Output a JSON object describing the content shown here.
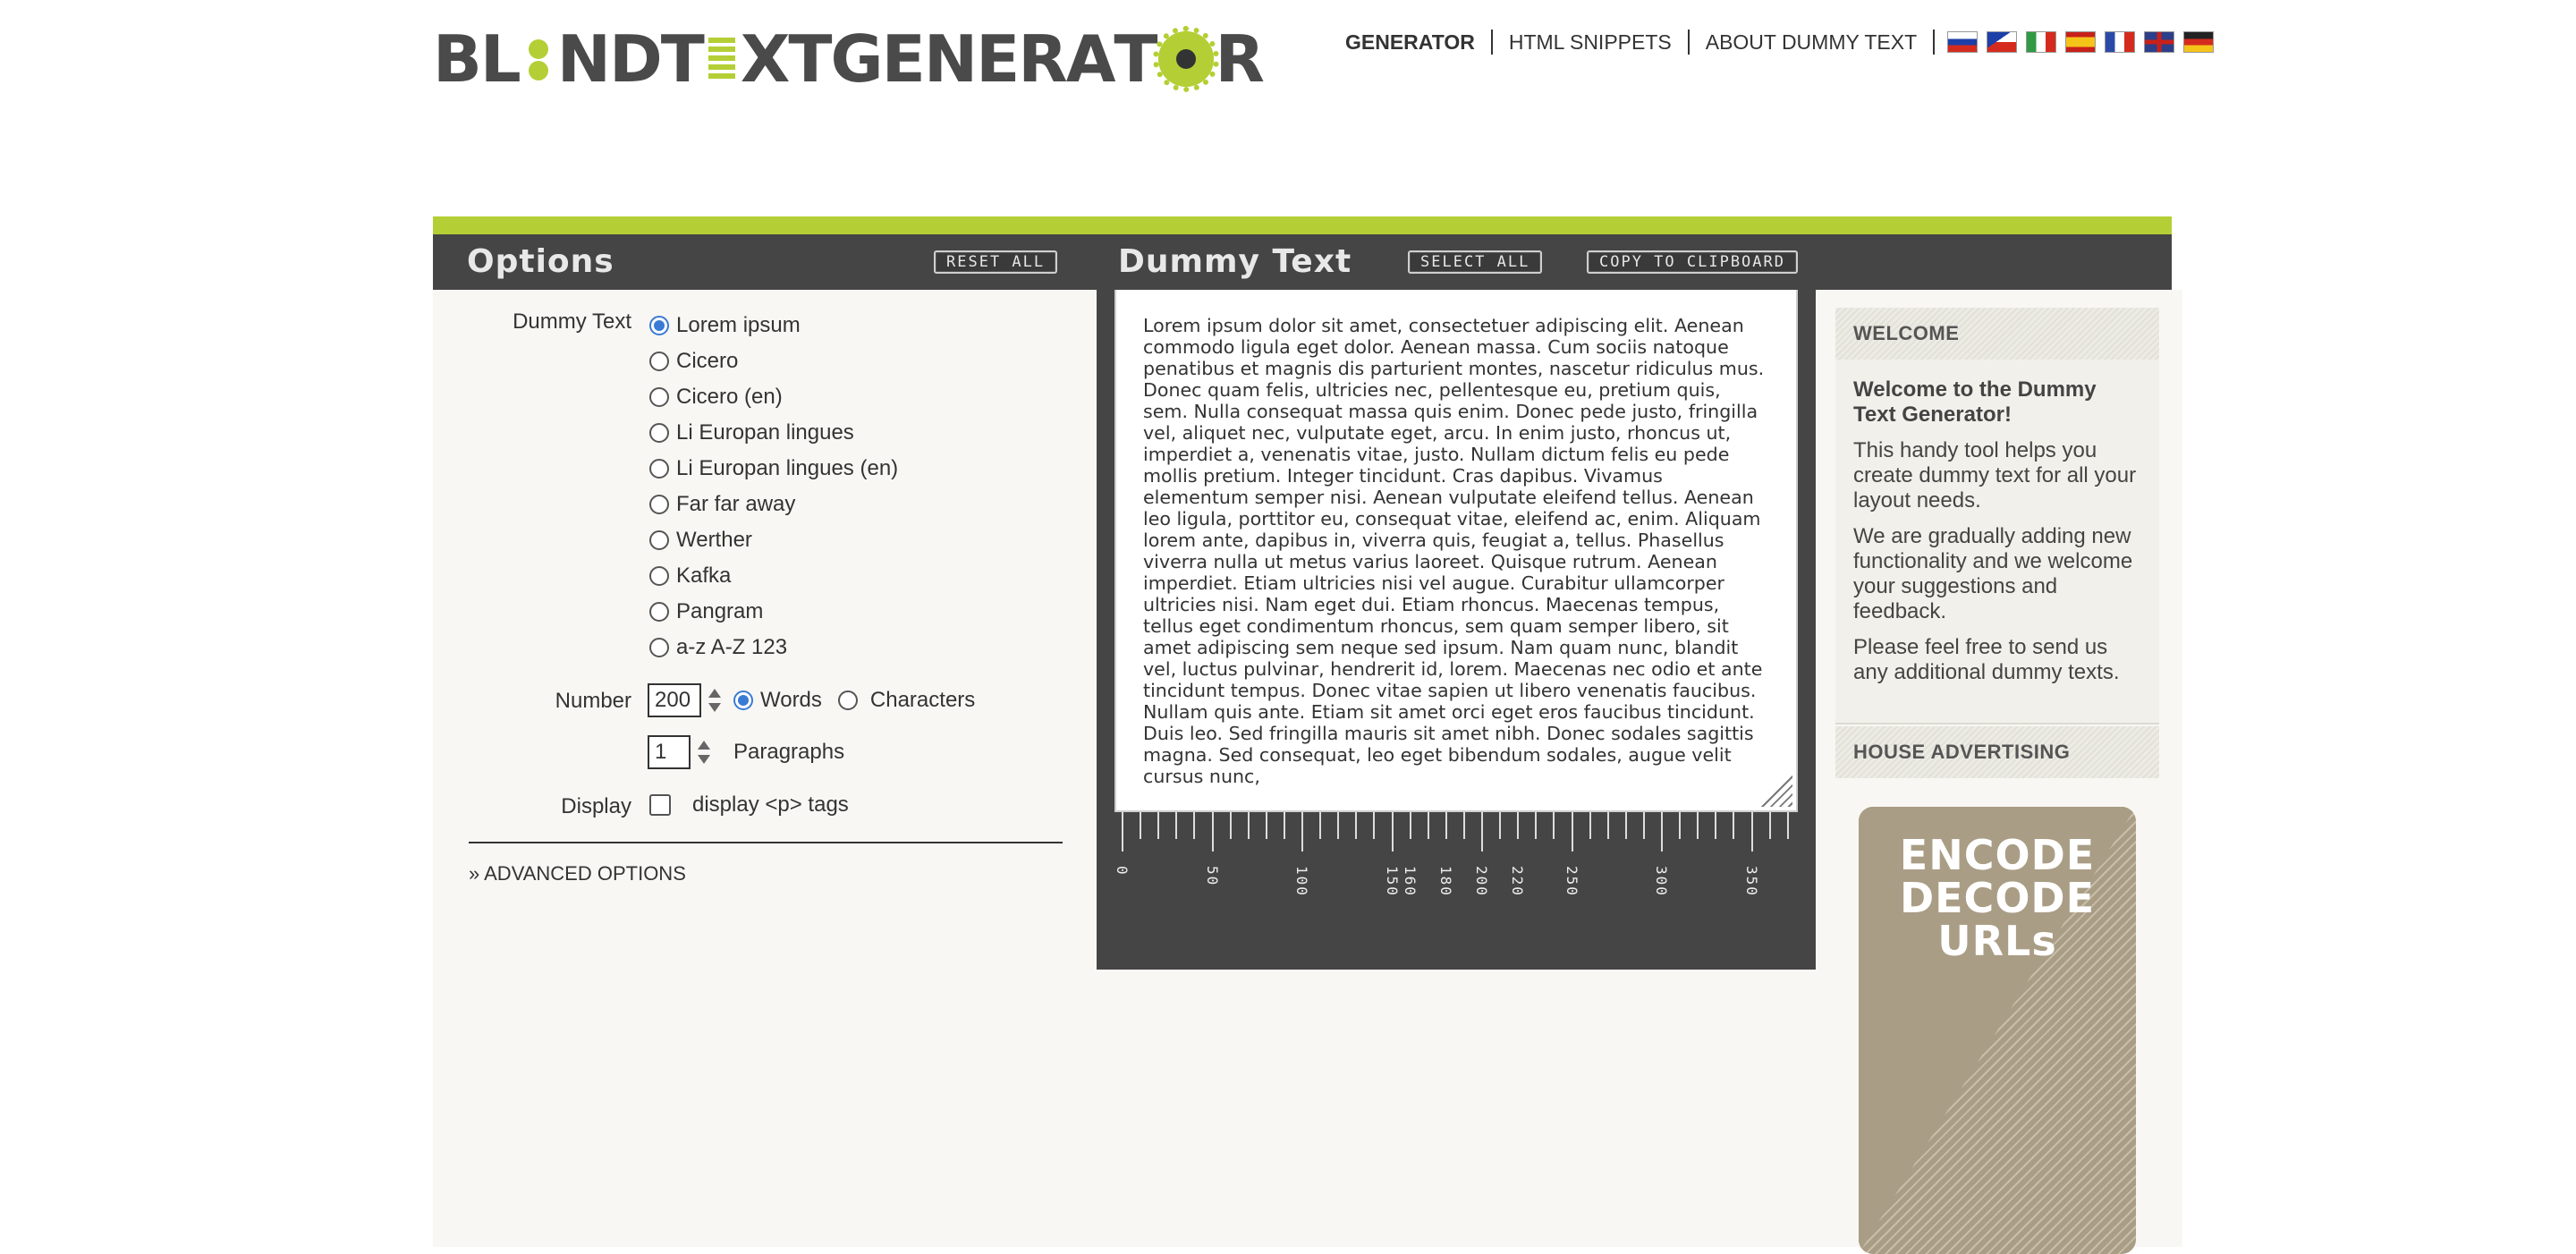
{
  "header": {
    "logo_text": "BL●NDT≡XTGENERAT●R",
    "nav": [
      {
        "label": "GENERATOR",
        "active": true
      },
      {
        "label": "HTML SNIPPETS",
        "active": false
      },
      {
        "label": "ABOUT DUMMY TEXT",
        "active": false
      }
    ],
    "flags": [
      "flag-russia-icon",
      "flag-czech-icon",
      "flag-italy-icon",
      "flag-spain-icon",
      "flag-france-icon",
      "flag-uk-icon",
      "flag-germany-icon"
    ]
  },
  "colors": {
    "accent_green": "#b4cf35",
    "dark_bar": "#454545",
    "panel_bg": "#f8f7f3"
  },
  "options": {
    "title": "Options",
    "reset_label": "RESET ALL",
    "dummy_text_label": "Dummy Text",
    "dummy_text_choices": [
      {
        "label": "Lorem ipsum",
        "selected": true
      },
      {
        "label": "Cicero",
        "selected": false
      },
      {
        "label": "Cicero (en)",
        "selected": false
      },
      {
        "label": "Li Europan lingues",
        "selected": false
      },
      {
        "label": "Li Europan lingues (en)",
        "selected": false
      },
      {
        "label": "Far far away",
        "selected": false
      },
      {
        "label": "Werther",
        "selected": false
      },
      {
        "label": "Kafka",
        "selected": false
      },
      {
        "label": "Pangram",
        "selected": false
      },
      {
        "label": "a-z A-Z 123",
        "selected": false
      }
    ],
    "number_label": "Number",
    "number_value": "200",
    "words_label": "Words",
    "words_selected": true,
    "characters_label": "Characters",
    "paragraphs_value": "1",
    "paragraphs_label": "Paragraphs",
    "display_label": "Display",
    "display_p_label": "display <p> tags",
    "display_p_checked": false,
    "advanced_label": "» ADVANCED OPTIONS"
  },
  "dummy": {
    "title": "Dummy Text",
    "select_all_label": "SELECT ALL",
    "copy_label": "COPY TO CLIPBOARD",
    "text": "Lorem ipsum dolor sit amet, consectetuer adipiscing elit. Aenean commodo ligula eget dolor. Aenean massa. Cum sociis natoque penatibus et magnis dis parturient montes, nascetur ridiculus mus. Donec quam felis, ultricies nec, pellentesque eu, pretium quis, sem. Nulla consequat massa quis enim. Donec pede justo, fringilla vel, aliquet nec, vulputate eget, arcu. In enim justo, rhoncus ut, imperdiet a, venenatis vitae, justo. Nullam dictum felis eu pede mollis pretium. Integer tincidunt. Cras dapibus. Vivamus elementum semper nisi. Aenean vulputate eleifend tellus. Aenean leo ligula, porttitor eu, consequat vitae, eleifend ac, enim. Aliquam lorem ante, dapibus in, viverra quis, feugiat a, tellus. Phasellus viverra nulla ut metus varius laoreet. Quisque rutrum. Aenean imperdiet. Etiam ultricies nisi vel augue. Curabitur ullamcorper ultricies nisi. Nam eget dui. Etiam rhoncus. Maecenas tempus, tellus eget condimentum rhoncus, sem quam semper libero, sit amet adipiscing sem neque sed ipsum. Nam quam nunc, blandit vel, luctus pulvinar, hendrerit id, lorem. Maecenas nec odio et ante tincidunt tempus. Donec vitae sapien ut libero venenatis faucibus. Nullam quis ante. Etiam sit amet orci eget eros faucibus tincidunt. Duis leo. Sed fringilla mauris sit amet nibh. Donec sodales sagittis magna. Sed consequat, leo eget bibendum sodales, augue velit cursus nunc,",
    "ruler_labels": [
      "0",
      "50",
      "100",
      "150",
      "160",
      "180",
      "200",
      "220",
      "250",
      "300",
      "350"
    ]
  },
  "sidebar": {
    "welcome_head": "WELCOME",
    "welcome_title": "Welcome to the Dummy Text Generator!",
    "welcome_p1": "This handy tool helps you create dummy text for all your layout needs.",
    "welcome_p2": "We are gradually adding new functionality and we welcome your suggestions and feedback.",
    "welcome_p3": "Please feel free to send us any additional dummy texts.",
    "ads_head": "HOUSE ADVERTISING",
    "ad_text": "ENCODE DECODE URLs"
  }
}
